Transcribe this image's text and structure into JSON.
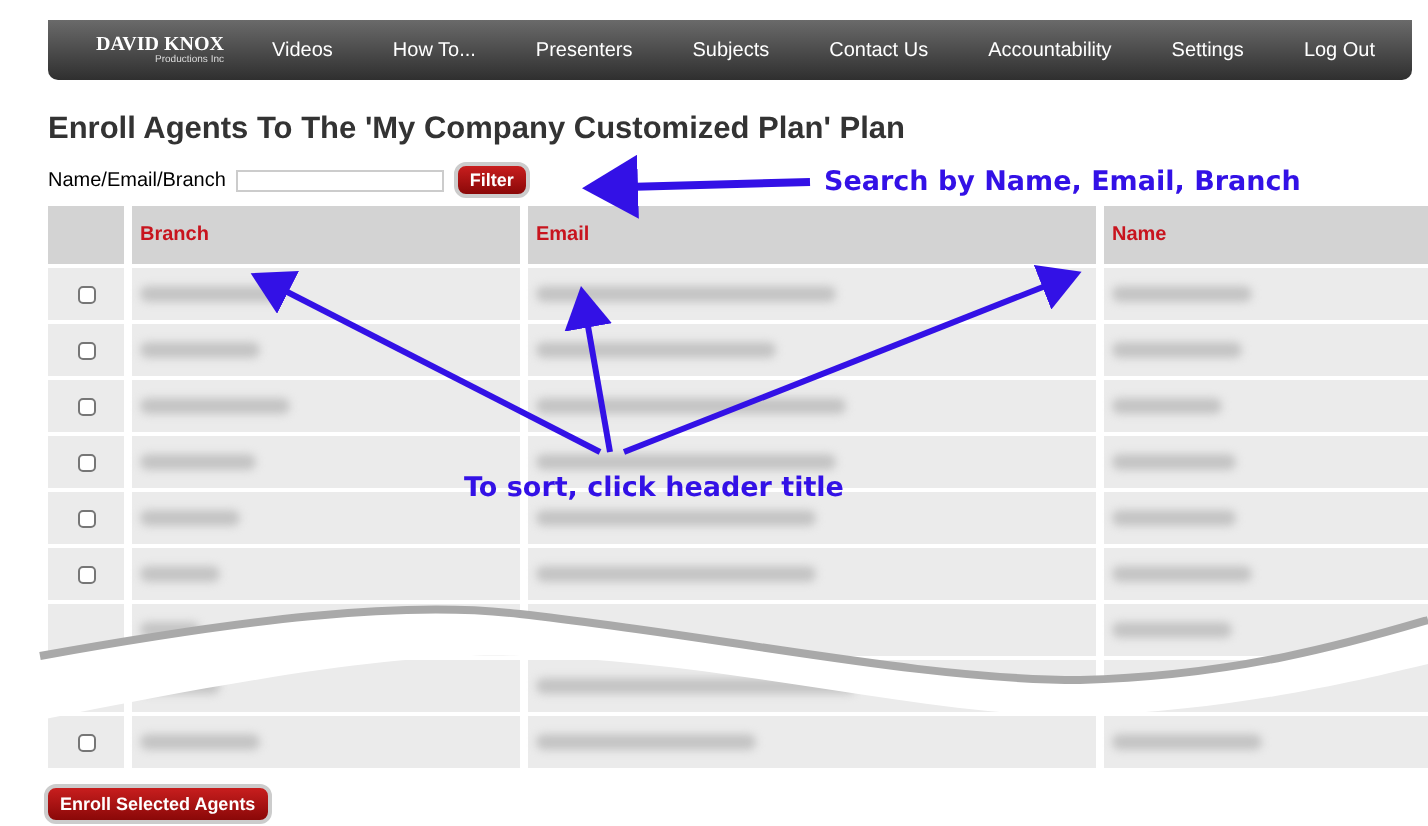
{
  "nav": {
    "logo": {
      "title": "DAVID KNOX",
      "subtitle": "Productions Inc"
    },
    "items": [
      {
        "label": "Videos"
      },
      {
        "label": "How To..."
      },
      {
        "label": "Presenters"
      },
      {
        "label": "Subjects"
      },
      {
        "label": "Contact Us"
      },
      {
        "label": "Accountability"
      },
      {
        "label": "Settings"
      },
      {
        "label": "Log Out"
      }
    ]
  },
  "title": "Enroll Agents To The 'My Company Customized Plan' Plan",
  "filter": {
    "label": "Name/Email/Branch",
    "button": "Filter"
  },
  "table": {
    "columns": [
      "Branch",
      "Email",
      "Name"
    ],
    "rows": [
      {
        "checked": false
      },
      {
        "checked": false
      },
      {
        "checked": false
      },
      {
        "checked": false
      },
      {
        "checked": false
      },
      {
        "checked": false
      },
      {},
      {},
      {
        "checked": false
      }
    ]
  },
  "submit": "Enroll Selected Agents",
  "annotations": {
    "search": "Search by Name, Email, Branch",
    "sort": "To sort, click header title"
  }
}
